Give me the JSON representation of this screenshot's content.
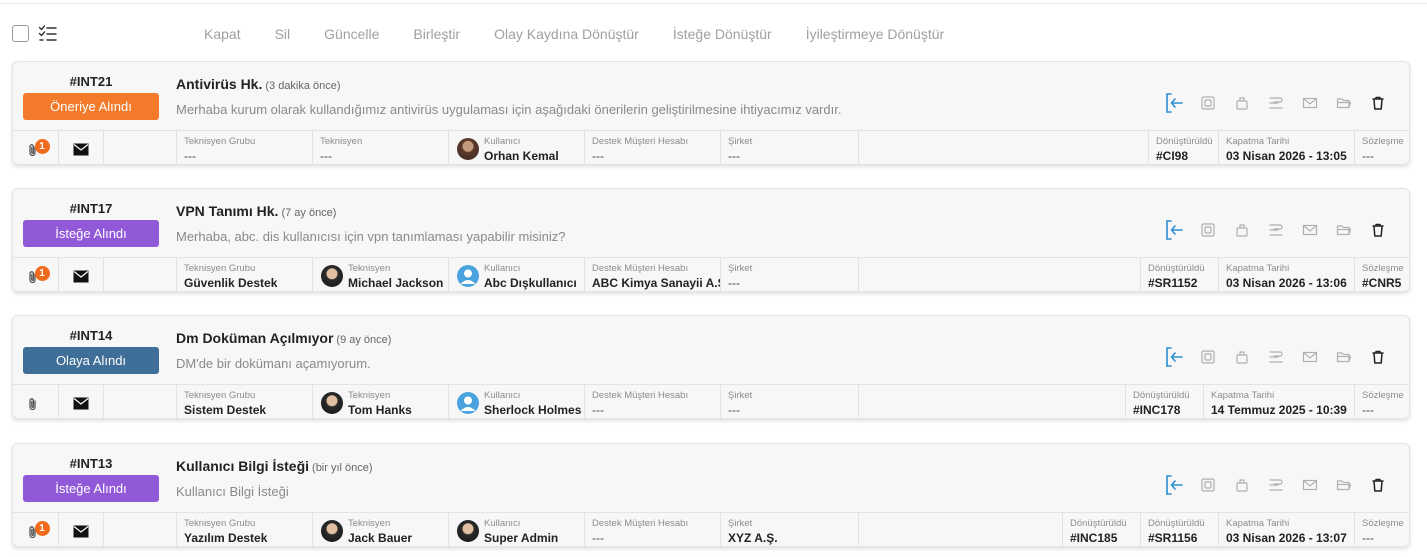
{
  "toolbar": {
    "actions": [
      "Kapat",
      "Sil",
      "Güncelle",
      "Birleştir",
      "Olay Kaydına Dönüştür",
      "İsteğe Dönüştür",
      "İyileştirmeye Dönüştür"
    ]
  },
  "labels": {
    "tech_group": "Teknisyen Grubu",
    "tech": "Teknisyen",
    "user": "Kullanıcı",
    "account": "Destek Müşteri Hesabı",
    "company": "Şirket",
    "converted": "Dönüştürüldü",
    "close_date": "Kapatma Tarihi",
    "contract": "Sözleşme"
  },
  "colors": {
    "orange": "#f37a2a",
    "purple": "#9159d8",
    "blue": "#3f6e99",
    "accent": "#2b8fcf",
    "count": "#f26b1d"
  },
  "tickets": [
    {
      "id": "#INT21",
      "status": "Öneriye Alındı",
      "status_color": "orange",
      "title": "Antivirüs Hk.",
      "ago": "(3 dakika önce)",
      "desc": "Merhaba kurum olarak kullandığımız antivirüs uygulaması için aşağıdaki önerilerin geliştirilmesine ihtiyacımız vardır.",
      "attach_count": "1",
      "tech_group": "---",
      "tech": "---",
      "tech_avatar": "none",
      "user": "Orhan Kemal",
      "user_avatar": "photo",
      "account": "---",
      "company": "---",
      "converted": [
        "#CI98"
      ],
      "close_date": "03 Nisan 2026 - 13:05",
      "contract": "---"
    },
    {
      "id": "#INT17",
      "status": "İsteğe Alındı",
      "status_color": "purple",
      "title": "VPN Tanımı Hk.",
      "ago": "(7 ay önce)",
      "desc": "Merhaba, abc. dis kullanıcısı için vpn tanımlaması yapabilir misiniz?",
      "attach_count": "1",
      "tech_group": "Güvenlik Destek",
      "tech": "Michael Jackson",
      "tech_avatar": "dark",
      "user": "Abc Dışkullanıcı",
      "user_avatar": "default",
      "account": "ABC Kimya Sanayii A.Ş.",
      "company": "---",
      "converted": [
        "#SR1152"
      ],
      "close_date": "03 Nisan 2026 - 13:06",
      "contract": "#CNR5"
    },
    {
      "id": "#INT14",
      "status": "Olaya Alındı",
      "status_color": "blue",
      "title": "Dm Doküman Açılmıyor",
      "ago": "(9 ay önce)",
      "desc": "DM'de bir dokümanı açamıyorum.",
      "attach_count": "",
      "tech_group": "Sistem Destek",
      "tech": "Tom Hanks",
      "tech_avatar": "dark",
      "user": "Sherlock Holmes",
      "user_avatar": "default",
      "account": "---",
      "company": "---",
      "converted": [
        "#INC178"
      ],
      "close_date": "14 Temmuz 2025 - 10:39",
      "contract": "---"
    },
    {
      "id": "#INT13",
      "status": "İsteğe Alındı",
      "status_color": "purple",
      "title": "Kullanıcı Bilgi İsteği",
      "ago": "(bir yıl önce)",
      "desc": "Kullanıcı Bilgi İsteği",
      "attach_count": "1",
      "tech_group": "Yazılım Destek",
      "tech": "Jack Bauer",
      "tech_avatar": "dark",
      "user": "Super Admin",
      "user_avatar": "dark",
      "account": "---",
      "company": "XYZ A.Ş.",
      "converted": [
        "#INC185",
        "#SR1156"
      ],
      "close_date": "03 Nisan 2026 - 13:07",
      "contract": "---"
    }
  ]
}
